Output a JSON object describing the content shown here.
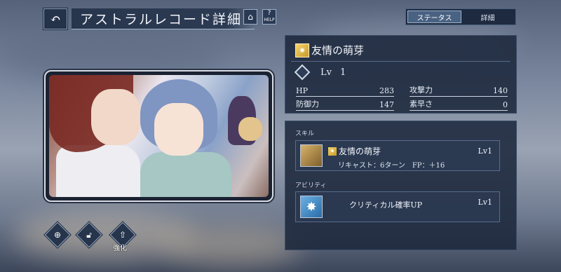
{
  "header": {
    "title": "アストラルレコード詳細",
    "back_icon": "back-arrow-icon",
    "home_icon": "home-icon",
    "help_label": "HELP"
  },
  "tabs": [
    {
      "label": "ステータス",
      "active": true
    },
    {
      "label": "詳細",
      "active": false
    }
  ],
  "card": {
    "name": "友情の萌芽",
    "level_label": "Lv",
    "level": "1",
    "stats": {
      "hp": {
        "label": "HP",
        "value": "283"
      },
      "atk": {
        "label": "攻撃力",
        "value": "140"
      },
      "def": {
        "label": "防御力",
        "value": "147"
      },
      "spd": {
        "label": "素早さ",
        "value": "0"
      }
    }
  },
  "skill_section": {
    "label": "スキル",
    "name": "友情の萌芽",
    "detail": "リキャスト：6ターン　FP：＋16",
    "level": "Lv1"
  },
  "ability_section": {
    "label": "アビリティ",
    "name": "クリティカル確率UP",
    "level": "Lv1"
  },
  "bottom_actions": {
    "zoom_icon": "zoom-in-icon",
    "lock_icon": "unlock-icon",
    "upgrade_label": "強化"
  },
  "colors": {
    "panel": "#1c283c",
    "accent_tab": "#4a6282",
    "gold_icon": "#f4d36a"
  }
}
